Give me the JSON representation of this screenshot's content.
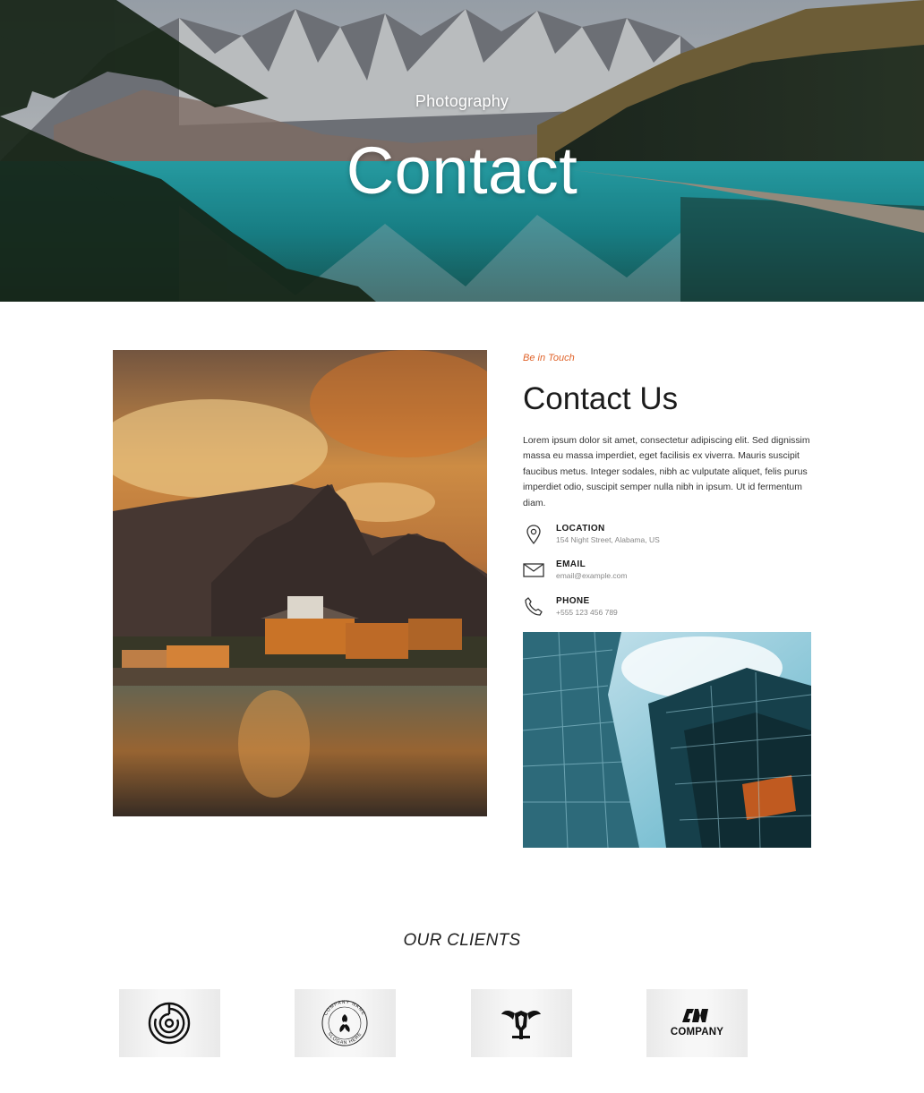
{
  "hero": {
    "kicker": "Photography",
    "title": "Contact"
  },
  "contact": {
    "kicker": "Be in Touch",
    "title": "Contact Us",
    "description": "Lorem ipsum dolor sit amet, consectetur adipiscing elit. Sed dignissim massa eu massa imperdiet, eget facilisis ex viverra. Mauris suscipit faucibus metus. Integer sodales, nibh ac vulputate aliquet, felis purus imperdiet odio, suscipit semper nulla nibh in ipsum. Ut id fermentum diam.",
    "items": [
      {
        "label": "LOCATION",
        "value": "154 Night Street, Alabama, US",
        "icon": "location-pin-icon"
      },
      {
        "label": "EMAIL",
        "value": "email@example.com",
        "icon": "envelope-icon"
      },
      {
        "label": "PHONE",
        "value": "+555 123 456 789",
        "icon": "phone-icon"
      }
    ]
  },
  "clients": {
    "title": "OUR CLIENTS",
    "logos": [
      {
        "name": "circular-maze-logo"
      },
      {
        "name": "company-name-slogan-logo",
        "text_top": "COMPANY NAME",
        "text_bottom": "SLOGAN HERE"
      },
      {
        "name": "winged-shield-logo"
      },
      {
        "name": "cn-company-logo",
        "text": "COMPANY"
      }
    ]
  },
  "colors": {
    "accent": "#e0632a",
    "heading": "#1c1c1c",
    "muted": "#888888"
  }
}
